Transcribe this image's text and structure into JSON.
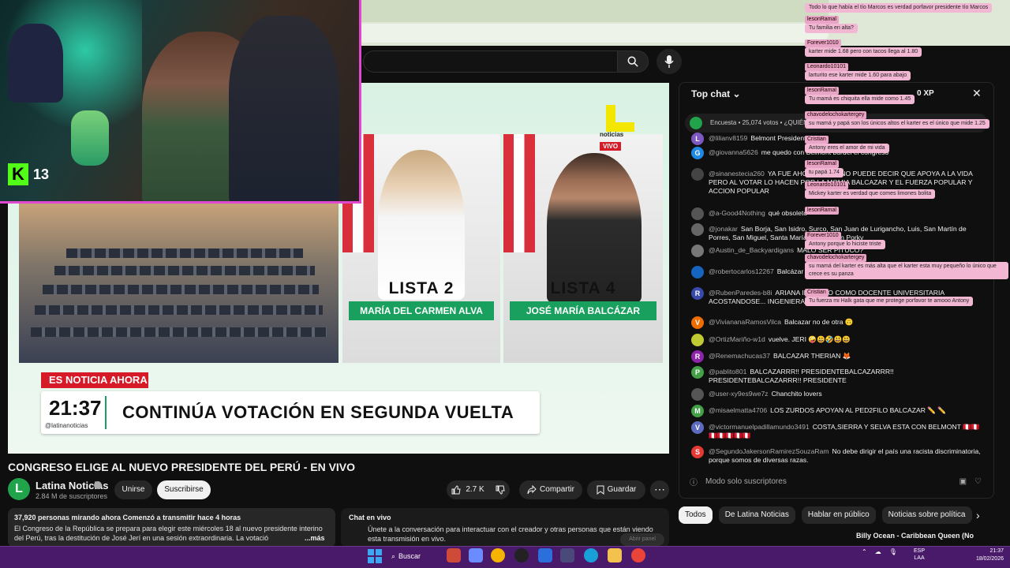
{
  "youtube": {
    "video_title": "CONGRESO ELIGE AL NUEVO PRESIDENTE DEL PERÚ - EN VIVO",
    "channel_name": "Latina Noticias",
    "channel_avatar_letter": "L",
    "subscribers": "2.84 M de suscriptores",
    "join_label": "Unirse",
    "subscribe_label": "Suscribirse",
    "likes": "2.7 K",
    "share_label": "Compartir",
    "save_label": "Guardar",
    "description_stats": "37,920 personas mirando ahora  Comenzó a transmitir hace 4 horas",
    "description_text": "El Congreso de la República se prepara para elegir este miércoles 18 al nuevo presidente interino del Perú, tras la destitución de José Jerí en una sesión extraordinaria. La votació",
    "description_more": "...más",
    "live_chat_card_title": "Chat en vivo",
    "live_chat_card_text": "Únete a la conversación para interactuar con el creador y otras personas que están viendo esta transmisión en vivo.",
    "hide_panel": "Abrir panel",
    "search_placeholder": ""
  },
  "broadcast": {
    "logo_letter": "L",
    "logo_word": "noticias",
    "live_tag": "VIVO",
    "list_left_title": "LISTA 2",
    "list_left_name": "MARÍA DEL CARMEN ALVA",
    "list_right_title": "LISTA 4",
    "list_right_name": "JOSÉ MARÍA BALCÁZAR",
    "breaking_tag": "ES NOTICIA AHORA",
    "clock": "21:37",
    "handle": "@latinanoticias",
    "headline": "CONTINÚA VOTACIÓN EN SEGUNDA VUELTA"
  },
  "webcam": {
    "platform_letter": "K",
    "viewer_count": "13"
  },
  "chat": {
    "header_title": "Top chat",
    "viewers": "0 XP",
    "poll": "Encuesta • 25,074 votos • ¿QUIÉN",
    "input_placeholder": "Modo solo suscriptores",
    "messages": [
      {
        "initial": "L",
        "color": "#7e57c2",
        "user": "@lilianv8159",
        "text": "Belmont Presidente"
      },
      {
        "initial": "G",
        "color": "#1e88e5",
        "user": "@giovanna5626",
        "text": "me quedo con Belmont burdel el congreso"
      },
      {
        "initial": "",
        "color": "#444",
        "user": "@sinanestecia260",
        "text": "YA FUE AHORA, ACA UNO PUEDE DECIR QUE APOYA A LA VIDA PERO AL VOTAR LO HACEN POR LA MOMIA BALCAZAR Y EL FUERZA POPULAR Y ACCION POPULAR"
      },
      {
        "initial": "",
        "color": "#555",
        "user": "@a-Good4Nothing",
        "text": "qué obsoleto"
      },
      {
        "initial": "",
        "color": "#666",
        "user": "@jonakar",
        "text": "San Borja, San Isidro, Surco, San Juan de Lurigancho, Luis, San Martín de Porres, San Miguel, Santa María del Mar con Porky"
      },
      {
        "initial": "",
        "color": "#777",
        "user": "@Austin_de_Backyardigans",
        "text": "MALO SER PITUCO?"
      },
      {
        "initial": "",
        "color": "#1565c0",
        "user": "@robertocarlos12267",
        "text": "Balcázar que se vayan a México"
      },
      {
        "initial": "R",
        "color": "#3949ab",
        "user": "@RubenParedes-b8i",
        "text": "ARIANA INGRESO COMO DOCENTE UNIVERSITARIA ACOSTANDOSE... INGENIERA DE SISTEMAS"
      },
      {
        "initial": "V",
        "color": "#ef6c00",
        "user": "@ViviananaRamosVilca",
        "text": "Balcazar no de otra 🙃"
      },
      {
        "initial": "",
        "color": "#c0ca33",
        "user": "@OrtizMariño-w1d",
        "text": "vuelve. JERI 🤪😃🤣😃😃"
      },
      {
        "initial": "R",
        "color": "#8e24aa",
        "user": "@Renemachucas37",
        "text": "BALCAZAR THERIAN 🦊"
      },
      {
        "initial": "P",
        "color": "#43a047",
        "user": "@pablito801",
        "text": "BALCAZARRR!! PRESIDENTEBALCAZARRR!! PRESIDENTEBALCAZARRR!! PRESIDENTE"
      },
      {
        "initial": "",
        "color": "#555",
        "user": "@user-xy9es9we7z",
        "text": "Chanchito lovers"
      },
      {
        "initial": "M",
        "color": "#43a047",
        "user": "@misaelmatta4706",
        "text": "LOS ZURDOS APOYAN AL PED2FILO BALCAZAR ✏️ ✏️"
      },
      {
        "initial": "V",
        "color": "#5c6bc0",
        "user": "@victormanuelpadillamundo3491",
        "text": "COSTA,SIERRA Y SELVA ESTA CON BELMONT 🇵🇪🇵🇪🇵🇪🇵🇪🇵🇪🇵🇪🇵🇪"
      },
      {
        "initial": "S",
        "color": "#e53935",
        "user": "@SegundoJakersonRamirezSouzaRam",
        "text": "No debe dirigir el país una racista discriminatoria, porque somos de diversas razas."
      }
    ]
  },
  "overlay_chat": [
    {
      "badge": "",
      "text": "Todo lo que había el tío Marcos es verdad porfavor presidente tío Marcos"
    },
    {
      "badge": "lesonRamal",
      "text": "Tu familia en alta?"
    },
    {
      "badge": "Forever1010",
      "text": "karter mide 1.68 pero con tacos llega al 1.80"
    },
    {
      "badge": "Leonardo10101",
      "text": "larturito ese karter mide 1.60 para abajo"
    },
    {
      "badge": "lesonRamal",
      "text": "Tu mamá es chiquita ella mide como 1.45"
    },
    {
      "badge": "chavodelochokartergey",
      "text": "su mamá y papá son los únicos altos el karter es el único que mide 1.25"
    },
    {
      "badge": "Cristian",
      "text": "Antony eres el amor de mi vida"
    },
    {
      "badge": "lesonRamal",
      "text": "tu papá 1.74"
    },
    {
      "badge": "Leonardo10101",
      "text": "Mickey karter es verdad que comes limones bolita"
    },
    {
      "badge": "lesonRamal",
      "text": ""
    },
    {
      "badge": "Forever1010",
      "text": "Antony porque lo hiciste triste"
    },
    {
      "badge": "chavodelochokartergey",
      "text": "su mamá del karter es más alta que el karter esta muy pequeño lo único que crece es su panza"
    },
    {
      "badge": "Cristian",
      "text": "Tu fuerza mi Halk gata que me protege porfavor te amooo Antony"
    }
  ],
  "chips": [
    "Todos",
    "De Latina Noticias",
    "Hablar en público",
    "Noticias sobre política"
  ],
  "recommended": "Billy Ocean - Caribbean Queen (No",
  "taskbar": {
    "search_label": "Buscar",
    "lang_top": "ESP",
    "lang_bottom": "LAA",
    "time": "21:37",
    "date": "18/02/2026"
  }
}
